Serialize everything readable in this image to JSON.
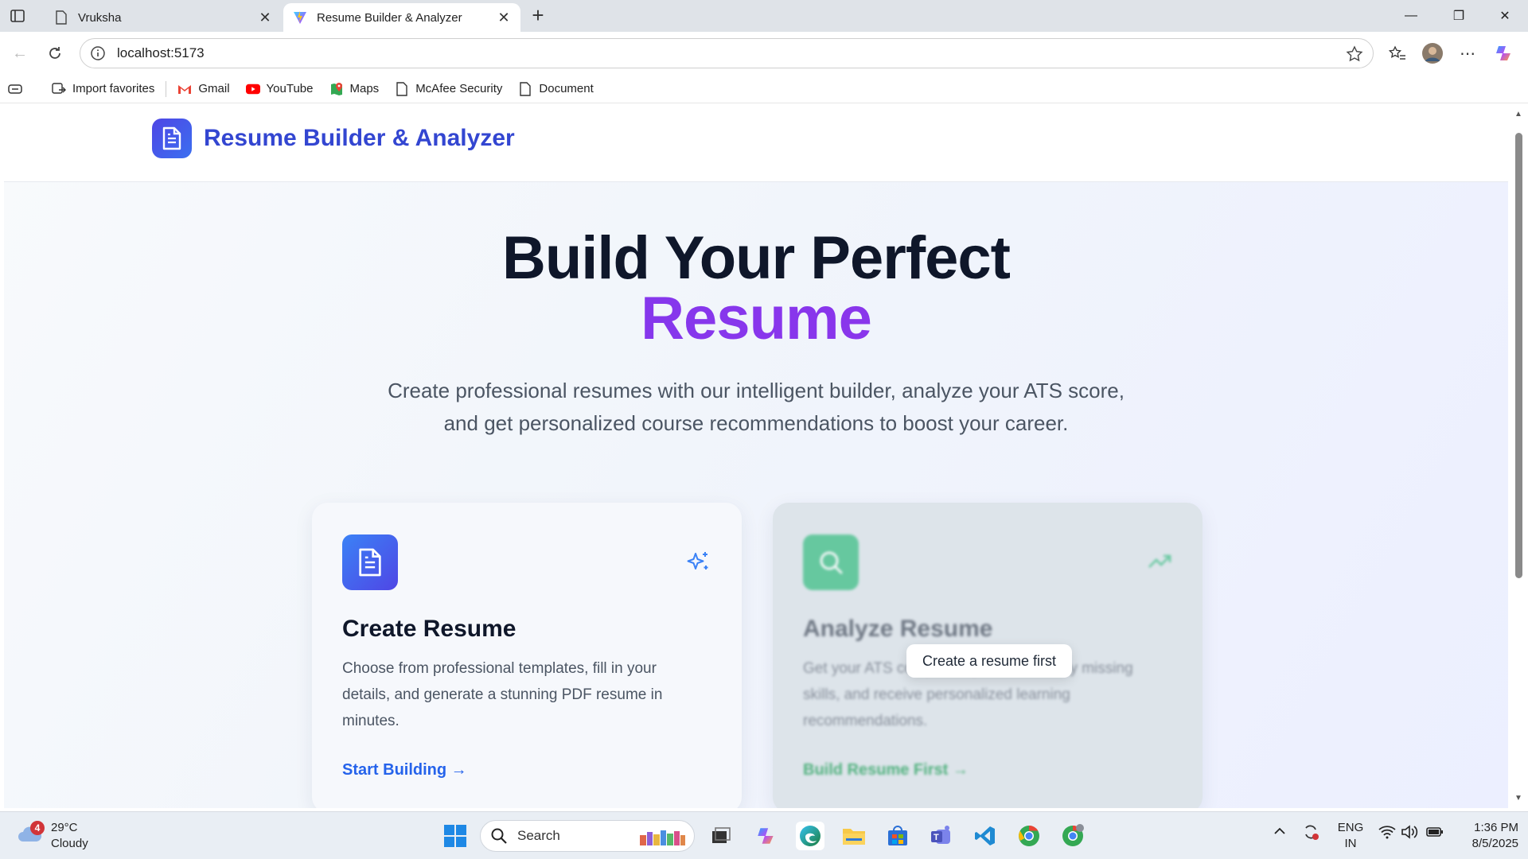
{
  "browser": {
    "tabs": [
      {
        "title": "Vruksha",
        "active": false
      },
      {
        "title": "Resume Builder & Analyzer",
        "active": true
      }
    ],
    "url": "localhost:5173",
    "bookmarks": [
      {
        "label": "Import favorites",
        "icon": "import-icon"
      },
      {
        "label": "Gmail",
        "icon": "gmail-icon"
      },
      {
        "label": "YouTube",
        "icon": "youtube-icon"
      },
      {
        "label": "Maps",
        "icon": "maps-icon"
      },
      {
        "label": "McAfee Security",
        "icon": "document-icon"
      },
      {
        "label": "Document",
        "icon": "document-icon"
      }
    ]
  },
  "app": {
    "title": "Resume Builder & Analyzer",
    "hero": {
      "line1": "Build Your Perfect",
      "line2": "Resume",
      "subtitle": "Create professional resumes with our intelligent builder, analyze your ATS score, and get personalized course recommendations to boost your career."
    },
    "cards": [
      {
        "title": "Create Resume",
        "description": "Choose from professional templates, fill in your details, and generate a stunning PDF resume in minutes.",
        "link": "Start Building →",
        "icon": "document-icon",
        "deco_icon": "sparkles-icon",
        "disabled": false
      },
      {
        "title": "Analyze Resume",
        "description": "Get your ATS compatibility score, identify missing skills, and receive personalized learning recommendations.",
        "link": "Build Resume First →",
        "icon": "search-icon",
        "deco_icon": "trending-up-icon",
        "disabled": true
      }
    ],
    "tooltip": "Create a resume first"
  },
  "colors": {
    "brand": "#3346d1",
    "accent_purple": "#7c3aed",
    "link_blue": "#2563eb",
    "analyze_green": "#22a05a"
  },
  "taskbar": {
    "weather": {
      "temp": "29°C",
      "condition": "Cloudy",
      "badge": "4"
    },
    "search_placeholder": "Search",
    "lang": {
      "line1": "ENG",
      "line2": "IN"
    },
    "time": "1:36 PM",
    "date": "8/5/2025"
  }
}
